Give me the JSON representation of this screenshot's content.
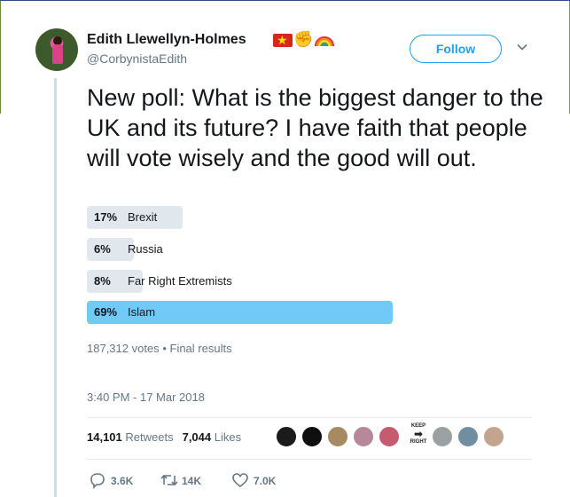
{
  "author": {
    "name": "Edith Llewellyn-Holmes",
    "handle": "@CorbynistaEdith",
    "badges": [
      "vietnam-flag-icon",
      "raised-fist-icon",
      "rainbow-icon"
    ]
  },
  "follow_label": "Follow",
  "tweet_text": "New poll: What is the biggest danger to the UK and its future? I have faith that people will vote wisely and the good will out.",
  "poll": {
    "options": [
      {
        "percent": "17%",
        "label": "Brexit",
        "value": 17,
        "winner": false
      },
      {
        "percent": "6%",
        "label": "Russia",
        "value": 6,
        "winner": false
      },
      {
        "percent": "8%",
        "label": "Far Right Extremists",
        "value": 8,
        "winner": false
      },
      {
        "percent": "69%",
        "label": "Islam",
        "value": 69,
        "winner": true
      }
    ],
    "votes": "187,312 votes",
    "separator": "•",
    "status": "Final results"
  },
  "timestamp": "3:40 PM - 17 Mar 2018",
  "stats": {
    "retweets_count": "14,101",
    "retweets_label": "Retweets",
    "likes_count": "7,044",
    "likes_label": "Likes"
  },
  "liker_sign": {
    "line1": "KEEP",
    "line2": "RIGHT"
  },
  "actions": {
    "replies": "3.6K",
    "retweets": "14K",
    "likes": "7.0K"
  },
  "colors": {
    "accent": "#1da1f2",
    "winner_bar": "#71c9f8",
    "bar": "#e1e8ed",
    "muted": "#657786"
  }
}
